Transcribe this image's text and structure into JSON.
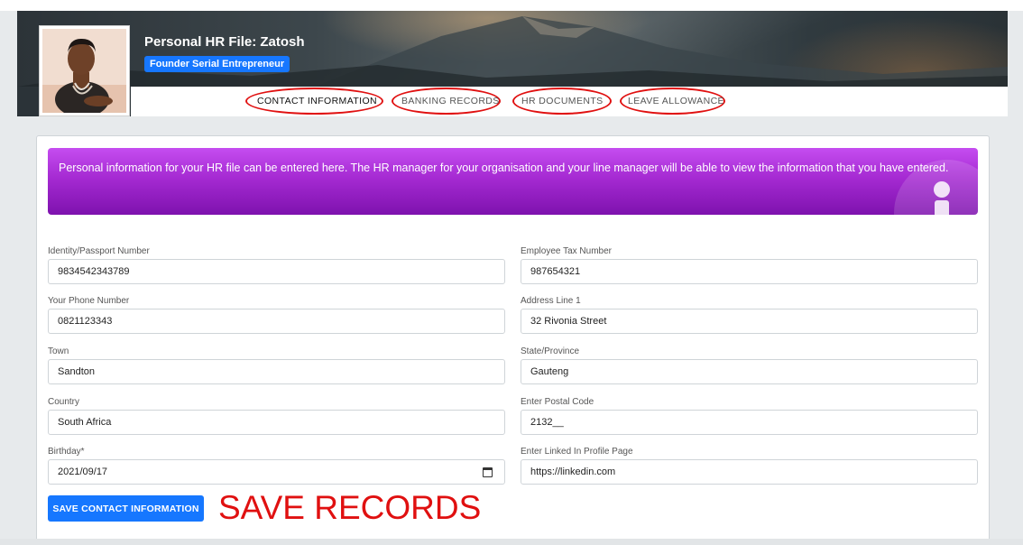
{
  "profile": {
    "title": "Personal HR File: Zatosh",
    "role_badge": "Founder Serial Entrepreneur"
  },
  "tabs": [
    {
      "label": "CONTACT INFORMATION",
      "active": true
    },
    {
      "label": "BANKING RECORDS",
      "active": false
    },
    {
      "label": "HR DOCUMENTS",
      "active": false
    },
    {
      "label": "LEAVE ALLOWANCE",
      "active": false
    }
  ],
  "info_banner": {
    "text": "Personal information for your HR file can be entered here. The HR manager for your organisation and your line manager will be able to view the information that you have entered.",
    "icon": "info-icon"
  },
  "form": {
    "identity": {
      "label": "Identity/Passport Number",
      "value": "9834542343789"
    },
    "tax": {
      "label": "Employee Tax Number",
      "value": "987654321"
    },
    "phone": {
      "label": "Your Phone Number",
      "value": "0821123343"
    },
    "address1": {
      "label": "Address Line 1",
      "value": "32 Rivonia Street"
    },
    "town": {
      "label": "Town",
      "value": "Sandton"
    },
    "state": {
      "label": "State/Province",
      "value": "Gauteng"
    },
    "country": {
      "label": "Country",
      "value": "South Africa"
    },
    "postal": {
      "label": "Enter Postal Code",
      "value": "2132__"
    },
    "birthday": {
      "label": "Birthday*",
      "value": "2021/09/17"
    },
    "linkedin": {
      "label": "Enter Linked In Profile Page",
      "value": "https://linkedin.com"
    }
  },
  "save_button": "SAVE CONTACT INFORMATION",
  "annotation": "SAVE RECORDS",
  "colors": {
    "accent": "#1677ff",
    "annotation_red": "#e01010",
    "banner_purple": "#a52ad2"
  }
}
